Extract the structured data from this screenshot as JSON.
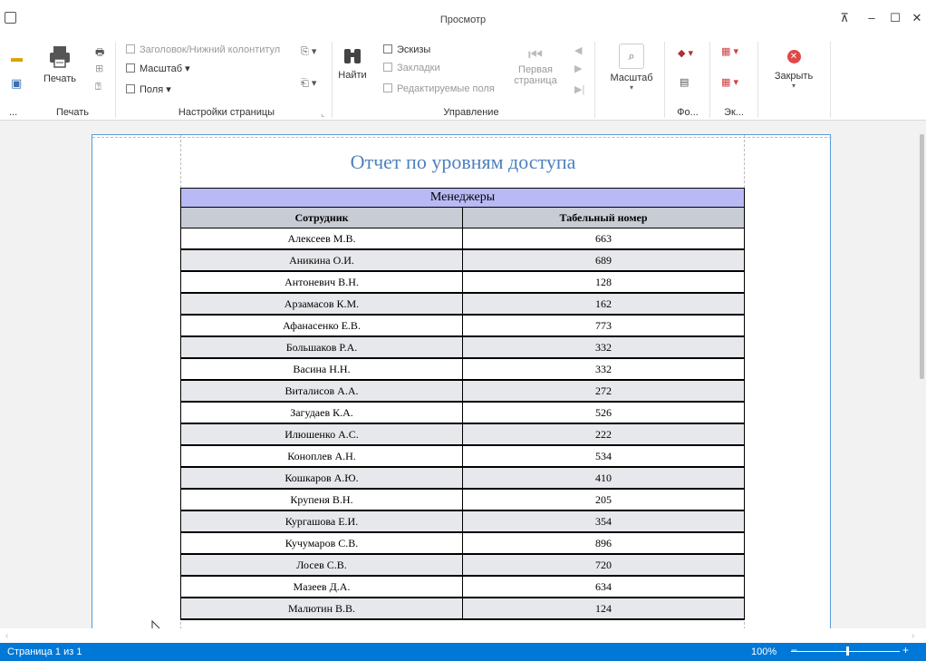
{
  "window": {
    "title": "Просмотр"
  },
  "ribbon": {
    "print_group": {
      "label": "Печать",
      "print_button": "Печать",
      "more": "..."
    },
    "page_setup": {
      "label": "Настройки страницы",
      "header_footer": "Заголовок/Нижний колонтитул",
      "scale": "Масштаб ▾",
      "margins": "Поля ▾"
    },
    "navigation": {
      "label": "Управление",
      "find": "Найти",
      "thumbnails": "Эскизы",
      "bookmarks": "Закладки",
      "editable_fields": "Редактируемые поля",
      "first_page_line1": "Первая",
      "first_page_line2": "страница"
    },
    "zoom": {
      "label": "Масштаб"
    },
    "background": {
      "label": "Фо..."
    },
    "export": {
      "label": "Эк..."
    },
    "close": {
      "label": "Закрыть"
    }
  },
  "report": {
    "title": "Отчет по уровням доступа",
    "group": "Менеджеры",
    "columns": [
      "Сотрудник",
      "Табельный номер"
    ],
    "rows": [
      [
        "Алексеев М.В.",
        "663"
      ],
      [
        "Аникина О.И.",
        "689"
      ],
      [
        "Антоневич В.Н.",
        "128"
      ],
      [
        "Арзамасов К.М.",
        "162"
      ],
      [
        "Афанасенко Е.В.",
        "773"
      ],
      [
        "Большаков Р.А.",
        "332"
      ],
      [
        "Васина Н.Н.",
        "332"
      ],
      [
        "Виталисов А.А.",
        "272"
      ],
      [
        "Загудаев К.А.",
        "526"
      ],
      [
        "Илюшенко А.С.",
        "222"
      ],
      [
        "Коноплев А.Н.",
        "534"
      ],
      [
        "Кошкаров А.Ю.",
        "410"
      ],
      [
        "Крупеня В.Н.",
        "205"
      ],
      [
        "Кургашова Е.И.",
        "354"
      ],
      [
        "Кучумаров С.В.",
        "896"
      ],
      [
        "Лосев С.В.",
        "720"
      ],
      [
        "Мазеев Д.А.",
        "634"
      ],
      [
        "Малютин В.В.",
        "124"
      ]
    ]
  },
  "status": {
    "page": "Страница 1 из 1",
    "zoom": "100%"
  }
}
